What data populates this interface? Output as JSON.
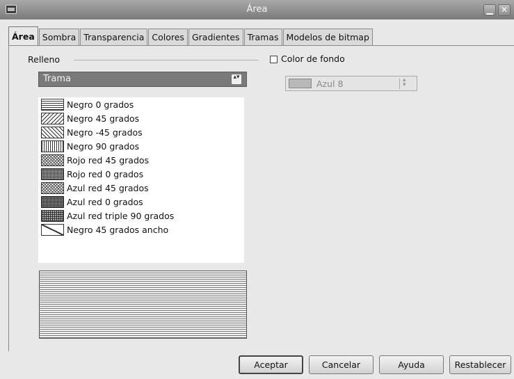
{
  "window": {
    "title": "Área",
    "minimize_glyph": "▁",
    "close_glyph": "✕"
  },
  "tabs": [
    {
      "label": "Área",
      "active": true
    },
    {
      "label": "Sombra"
    },
    {
      "label": "Transparencia"
    },
    {
      "label": "Colores"
    },
    {
      "label": "Gradientes"
    },
    {
      "label": "Tramas"
    },
    {
      "label": "Modelos de bitmap"
    }
  ],
  "fill": {
    "group_label": "Relleno",
    "type_value": "Trama",
    "spin_glyph": "▴▾",
    "items": [
      {
        "label": "Negro 0 grados",
        "icon": "pattern-horizontal"
      },
      {
        "label": "Negro 45 grados",
        "icon": "pattern-diagonal-45"
      },
      {
        "label": "Negro -45 grados",
        "icon": "pattern-diagonal-minus-45"
      },
      {
        "label": "Negro 90 grados",
        "icon": "pattern-vertical"
      },
      {
        "label": "Rojo red 45 grados",
        "icon": "pattern-crosshatch-45"
      },
      {
        "label": "Rojo red 0 grados",
        "icon": "pattern-grid"
      },
      {
        "label": "Azul red 45 grados",
        "icon": "pattern-crosshatch-45"
      },
      {
        "label": "Azul red 0 grados",
        "icon": "pattern-grid"
      },
      {
        "label": "Azul red triple 90 grados",
        "icon": "pattern-triple-grid"
      },
      {
        "label": "Negro 45 grados ancho",
        "icon": "pattern-wide-diagonal"
      }
    ]
  },
  "background": {
    "checkbox_label": "Color de fondo",
    "checked": false,
    "color_value": "Azul 8",
    "color_hex": "#b8b8b8"
  },
  "buttons": {
    "ok": "Aceptar",
    "cancel": "Cancelar",
    "help": "Ayuda",
    "reset": "Restablecer"
  }
}
